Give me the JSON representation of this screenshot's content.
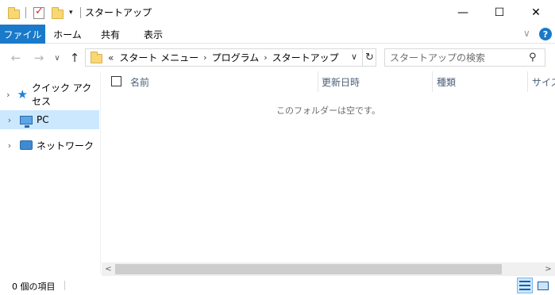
{
  "window": {
    "title": "スタートアップ",
    "minimize_glyph": "—",
    "maximize_glyph": "☐",
    "close_glyph": "✕"
  },
  "quick_access_toolbar": {
    "icons": [
      "folder-icon",
      "properties-icon",
      "new-folder-icon",
      "customize-dropdown-icon"
    ],
    "dropdown_glyph": "▾"
  },
  "ribbon": {
    "tabs": [
      {
        "label": "ファイル"
      },
      {
        "label": "ホーム"
      },
      {
        "label": "共有"
      },
      {
        "label": "表示"
      }
    ],
    "expand_glyph": "∨",
    "help_glyph": "?"
  },
  "navigation": {
    "back_glyph": "←",
    "forward_glyph": "→",
    "recent_glyph": "∨",
    "up_glyph": "↑"
  },
  "address": {
    "overflow_glyph": "«",
    "crumbs": [
      "スタート メニュー",
      "プログラム",
      "スタートアップ"
    ],
    "separator_glyph": "›",
    "dropdown_glyph": "∨",
    "refresh_glyph": "↻"
  },
  "search": {
    "placeholder": "スタートアップの検索",
    "icon_glyph": "⚲"
  },
  "nav_pane": {
    "items": [
      {
        "label": "クイック アクセス",
        "icon": "star-icon",
        "expand_glyph": "›",
        "selected": false
      },
      {
        "label": "PC",
        "icon": "pc-icon",
        "expand_glyph": "›",
        "selected": true
      },
      {
        "label": "ネットワーク",
        "icon": "network-icon",
        "expand_glyph": "›",
        "selected": false
      }
    ]
  },
  "file_list": {
    "sort_glyph": "^",
    "columns": [
      "名前",
      "更新日時",
      "種類",
      "サイズ"
    ],
    "empty_message": "このフォルダーは空です。"
  },
  "scrollbar": {
    "left_glyph": "<",
    "right_glyph": ">"
  },
  "status": {
    "item_count": "0 個の項目",
    "view_modes": [
      "details-view-icon",
      "large-icons-view-icon"
    ],
    "active_view": "details-view-icon"
  },
  "colors": {
    "accent": "#1979ca",
    "selection": "#cce8ff",
    "folder": "#f8d775",
    "column_header_text": "#4c607a"
  }
}
